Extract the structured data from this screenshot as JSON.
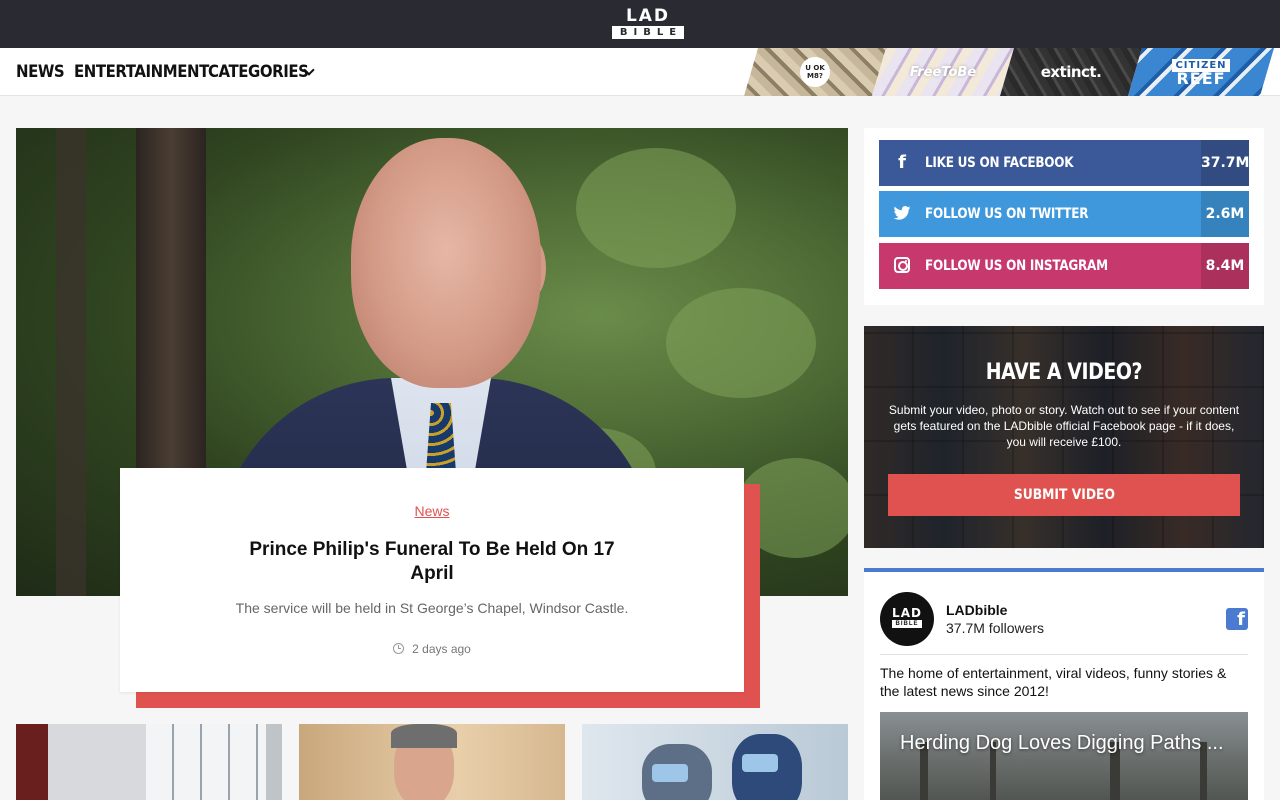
{
  "header": {
    "logo_top": "LAD",
    "logo_bottom": "BIBLE"
  },
  "nav": {
    "items": [
      {
        "label": "NEWS"
      },
      {
        "label": "ENTERTAINMENT"
      },
      {
        "label": "CATEGORIES"
      }
    ],
    "campaigns": {
      "uok": "U OK M8?",
      "freetobe": "FreeToBe",
      "extinct": "extinct.",
      "reef_top": "CITIZEN",
      "reef_bottom": "REEF"
    }
  },
  "hero": {
    "category": "News",
    "title": "Prince Philip's Funeral To Be Held On 17 April",
    "description": "The service will be held in St George’s Chapel, Windsor Castle.",
    "time": "2 days ago"
  },
  "social": [
    {
      "label": "LIKE US ON FACEBOOK",
      "count": "37.7M",
      "color": "#3b5998"
    },
    {
      "label": "FOLLOW US ON TWITTER",
      "count": "2.6M",
      "color": "#3f98db"
    },
    {
      "label": "FOLLOW US ON INSTAGRAM",
      "count": "8.4M",
      "color": "#c7386c"
    }
  ],
  "video_promo": {
    "title": "HAVE A VIDEO?",
    "description": "Submit your video, photo or story. Watch out to see if your content gets featured on the LADbible official Facebook page - if it does, you will receive £100.",
    "button": "SUBMIT VIDEO"
  },
  "fb_widget": {
    "avatar_top": "LAD",
    "avatar_bottom": "BIBLE",
    "name": "LADbible",
    "followers": "37.7M followers",
    "about": "The home of entertainment, viral videos, funny stories & the latest news since 2012!",
    "video_title": "Herding Dog Loves Digging Paths ..."
  },
  "colors": {
    "accent": "#e0524f",
    "topbar": "#2a2a33",
    "facebook": "#3b5998",
    "twitter": "#3f98db",
    "instagram": "#c7386c"
  }
}
